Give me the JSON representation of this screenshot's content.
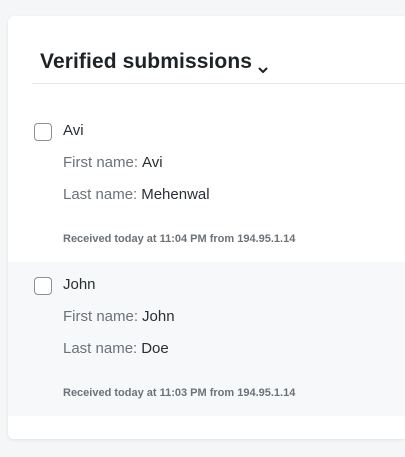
{
  "header": {
    "title": "Verified submissions",
    "dropdown_icon": "chevron-down-icon"
  },
  "submissions": [
    {
      "name": "Avi",
      "fields": [
        {
          "label": "First name:",
          "value": "Avi"
        },
        {
          "label": "Last name:",
          "value": "Mehenwal"
        }
      ],
      "received": "Received today at 11:04 PM from 194.95.1.14",
      "checked": false
    },
    {
      "name": "John",
      "fields": [
        {
          "label": "First name:",
          "value": "John"
        },
        {
          "label": "Last name:",
          "value": "Doe"
        }
      ],
      "received": "Received today at 11:03 PM from 194.95.1.14",
      "checked": false
    }
  ]
}
